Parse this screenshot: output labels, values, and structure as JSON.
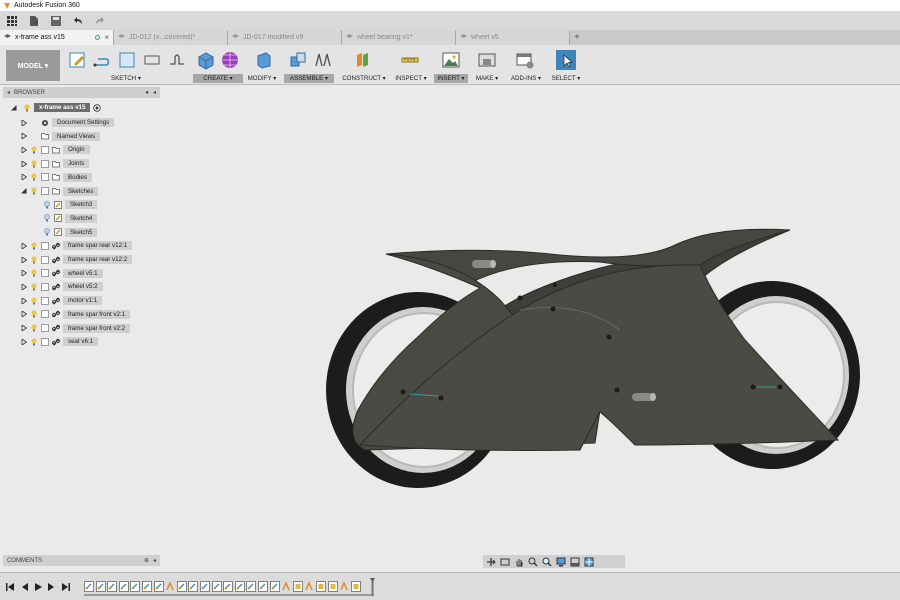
{
  "app": {
    "title": "Autodesk Fusion 360"
  },
  "quick_access": {
    "icons": [
      "grid-icon",
      "file-icon",
      "save-icon",
      "undo-icon",
      "redo-icon"
    ]
  },
  "tabs": [
    {
      "label": "x-frame ass v15",
      "active": true
    },
    {
      "label": "JD-012 (x...covered)*",
      "active": false
    },
    {
      "label": "JD-017 modified v9",
      "active": false
    },
    {
      "label": "wheel bearing v1*",
      "active": false
    },
    {
      "label": "wheel v5",
      "active": false
    }
  ],
  "ribbon": {
    "workspace": "MODEL ▾",
    "groups": [
      {
        "label": "SKETCH ▾",
        "highlight": false
      },
      {
        "label": "CREATE ▾",
        "highlight": true
      },
      {
        "label": "MODIFY ▾",
        "highlight": false
      },
      {
        "label": "ASSEMBLE ▾",
        "highlight": true
      },
      {
        "label": "CONSTRUCT ▾",
        "highlight": false
      },
      {
        "label": "INSPECT ▾",
        "highlight": false
      },
      {
        "label": "INSERT ▾",
        "highlight": true
      },
      {
        "label": "MAKE ▾",
        "highlight": false
      },
      {
        "label": "ADD-INS ▾",
        "highlight": false
      },
      {
        "label": "SELECT ▾",
        "highlight": false
      }
    ],
    "accent": "#3d87b8"
  },
  "browser": {
    "header": "BROWSER",
    "root": "x-frame ass v15",
    "items": [
      {
        "label": "Document Settings"
      },
      {
        "label": "Named Views"
      },
      {
        "label": "Origin"
      },
      {
        "label": "Joints"
      },
      {
        "label": "Bodies"
      },
      {
        "label": "Sketches"
      },
      {
        "label": "Sketch3"
      },
      {
        "label": "Sketch4"
      },
      {
        "label": "Sketch5"
      },
      {
        "label": "frame spar rear v12:1"
      },
      {
        "label": "frame spar rear v12:2"
      },
      {
        "label": "wheel v5:1"
      },
      {
        "label": "wheel v5:2"
      },
      {
        "label": "motor v1:1"
      },
      {
        "label": "frame spar front v2:1"
      },
      {
        "label": "frame spar front v2:2"
      },
      {
        "label": "seat v6:1"
      }
    ]
  },
  "comments": {
    "header": "COMMENTS"
  },
  "model": {
    "body_color": "#454540",
    "tire_color": "#1e1e1e",
    "rim_color": "#d8d8d8"
  }
}
